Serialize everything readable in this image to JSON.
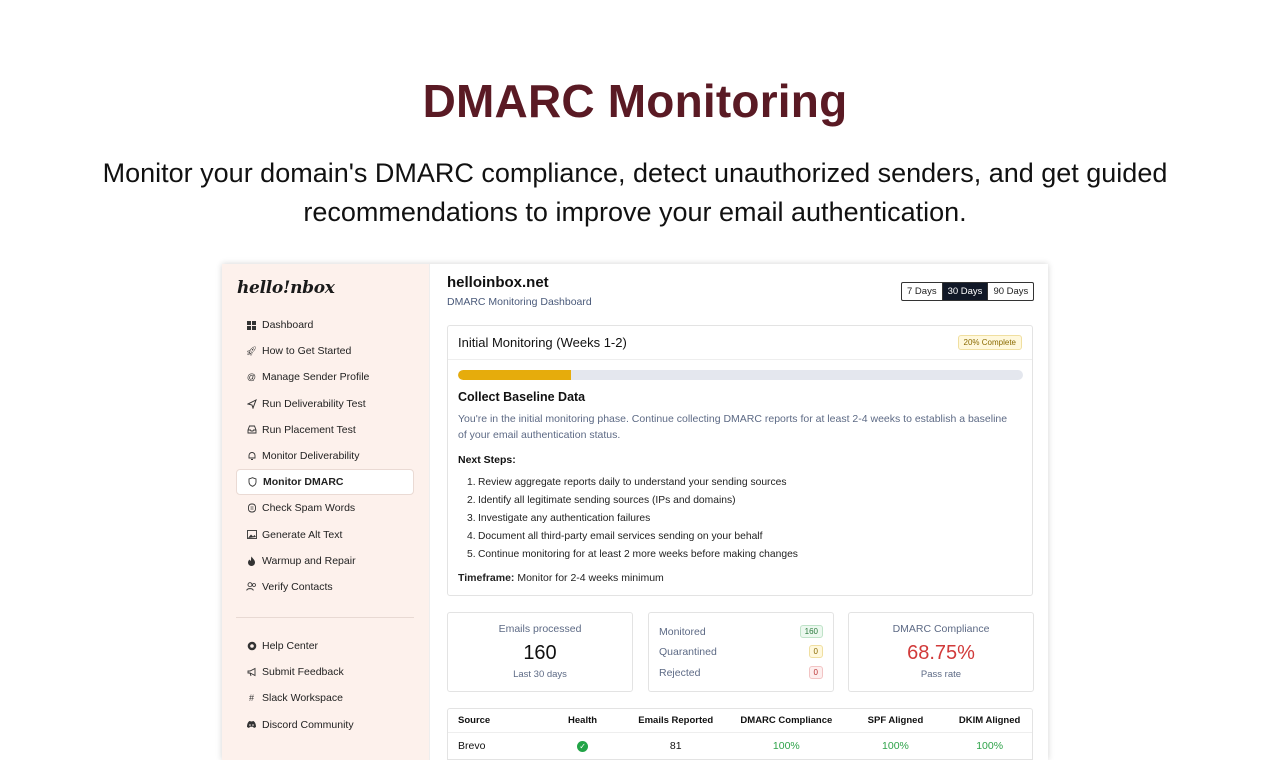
{
  "hero": {
    "title": "DMARC Monitoring",
    "subtitle": "Monitor your domain's DMARC compliance, detect unauthorized senders, and get guided recommendations to improve your email authentication."
  },
  "sidebar": {
    "logo": "hello!nbox",
    "items": [
      {
        "label": "Dashboard",
        "icon": "grid-icon"
      },
      {
        "label": "How to Get Started",
        "icon": "rocket-icon"
      },
      {
        "label": "Manage Sender Profile",
        "icon": "at-icon"
      },
      {
        "label": "Run Deliverability Test",
        "icon": "send-icon"
      },
      {
        "label": "Run Placement Test",
        "icon": "inbox-icon"
      },
      {
        "label": "Monitor Deliverability",
        "icon": "bell-icon"
      },
      {
        "label": "Monitor DMARC",
        "icon": "shield-icon"
      },
      {
        "label": "Check Spam Words",
        "icon": "spam-icon"
      },
      {
        "label": "Generate Alt Text",
        "icon": "image-icon"
      },
      {
        "label": "Warmup and Repair",
        "icon": "flame-icon"
      },
      {
        "label": "Verify Contacts",
        "icon": "users-icon"
      }
    ],
    "footer_items": [
      {
        "label": "Help Center",
        "icon": "lifebuoy-icon"
      },
      {
        "label": "Submit Feedback",
        "icon": "megaphone-icon"
      },
      {
        "label": "Slack Workspace",
        "icon": "slack-icon"
      },
      {
        "label": "Discord Community",
        "icon": "discord-icon"
      }
    ]
  },
  "header": {
    "domain": "helloinbox.net",
    "subtitle": "DMARC Monitoring Dashboard",
    "ranges": [
      "7 Days",
      "30 Days",
      "90 Days"
    ],
    "selected_range": "30 Days"
  },
  "phase": {
    "title": "Initial Monitoring (Weeks 1-2)",
    "badge": "20% Complete",
    "progress": 0.2,
    "heading": "Collect Baseline Data",
    "description": "You're in the initial monitoring phase. Continue collecting DMARC reports for at least 2-4 weeks to establish a baseline of your email authentication status.",
    "next_steps_title": "Next Steps:",
    "steps": [
      "Review aggregate reports daily to understand your sending sources",
      "Identify all legitimate sending sources (IPs and domains)",
      "Investigate any authentication failures",
      "Document all third-party email services sending on your behalf",
      "Continue monitoring for at least 2 more weeks before making changes"
    ],
    "timeframe_label": "Timeframe:",
    "timeframe_value": "Monitor for 2-4 weeks minimum"
  },
  "stats": {
    "emails": {
      "label": "Emails processed",
      "value": "160",
      "note": "Last 30 days"
    },
    "breakdown": [
      {
        "label": "Monitored",
        "value": "160",
        "tone": "green"
      },
      {
        "label": "Quarantined",
        "value": "0",
        "tone": "yellow"
      },
      {
        "label": "Rejected",
        "value": "0",
        "tone": "red"
      }
    ],
    "compliance": {
      "label": "DMARC Compliance",
      "value": "68.75%",
      "note": "Pass rate",
      "color": "#d13a3a"
    }
  },
  "table": {
    "columns": [
      "Source",
      "Health",
      "Emails Reported",
      "DMARC Compliance",
      "SPF Aligned",
      "DKIM Aligned"
    ],
    "rows": [
      {
        "source": "Brevo",
        "health": "check-icon",
        "emails": "81",
        "dmarc": "100%",
        "spf": "100%",
        "dkim": "100%"
      }
    ]
  },
  "colors": {
    "title": "#5a1a24",
    "sidebar_bg": "#fdf1ec",
    "progress": "#e6ac0c",
    "pass": "#2fa34a"
  }
}
